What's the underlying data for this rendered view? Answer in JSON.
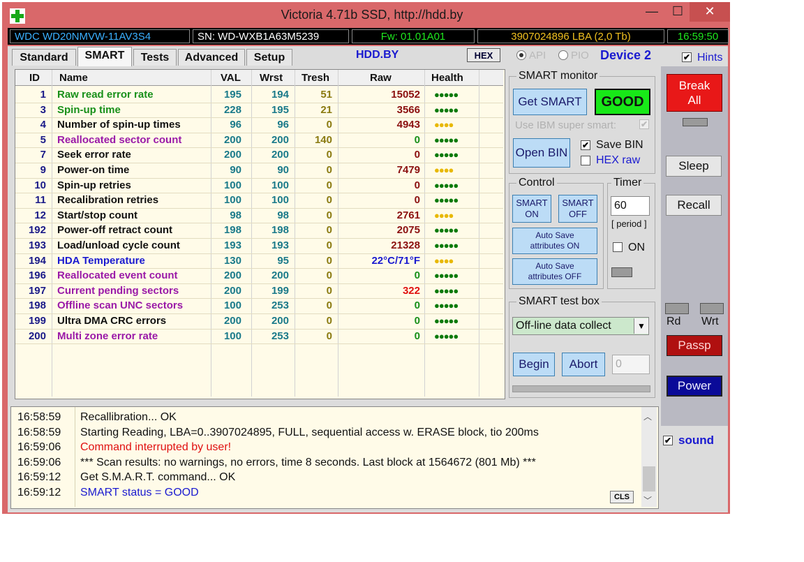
{
  "window": {
    "title": "Victoria 4.71b SSD, http://hdd.by",
    "minimize": "—",
    "maximize": "☐",
    "close": "✕"
  },
  "info_bar": {
    "model": "WDC WD20NMVW-11AV3S4",
    "serial": "SN: WD-WXB1A63M5239",
    "firmware": "Fw: 01.01A01",
    "lba": "3907024896 LBA (2,0 Tb)",
    "clock": "16:59:50"
  },
  "tabs": [
    {
      "label": "Standard",
      "active": false
    },
    {
      "label": "SMART",
      "active": true
    },
    {
      "label": "Tests",
      "active": false
    },
    {
      "label": "Advanced",
      "active": false
    },
    {
      "label": "Setup",
      "active": false
    }
  ],
  "toolbar": {
    "hddby": "HDD.BY",
    "hex_label": "HEX",
    "api_label": "API",
    "pio_label": "PIO",
    "device_label": "Device 2",
    "hints_label": "Hints",
    "hints_checked": true
  },
  "table": {
    "headers": [
      "ID",
      "Name",
      "VAL",
      "Wrst",
      "Tresh",
      "Raw",
      "Health"
    ],
    "rows": [
      {
        "id": "1",
        "name": "Raw read error rate",
        "val": "195",
        "wrst": "194",
        "tresh": "51",
        "raw": "15052",
        "health": "●●●●●",
        "name_color": "#18901a",
        "raw_color": "#8b1010",
        "health_color": "#0a7a0a"
      },
      {
        "id": "3",
        "name": "Spin-up time",
        "val": "228",
        "wrst": "195",
        "tresh": "21",
        "raw": "3566",
        "health": "●●●●●",
        "name_color": "#18901a",
        "raw_color": "#8b1010",
        "health_color": "#0a7a0a"
      },
      {
        "id": "4",
        "name": "Number of spin-up times",
        "val": "96",
        "wrst": "96",
        "tresh": "0",
        "raw": "4943",
        "health": "●●●●",
        "name_color": "#111111",
        "raw_color": "#8b1010",
        "health_color": "#e8b800"
      },
      {
        "id": "5",
        "name": "Reallocated sector count",
        "val": "200",
        "wrst": "200",
        "tresh": "140",
        "raw": "0",
        "health": "●●●●●",
        "name_color": "#9a1aa8",
        "raw_color": "#18901a",
        "health_color": "#0a7a0a"
      },
      {
        "id": "7",
        "name": "Seek error rate",
        "val": "200",
        "wrst": "200",
        "tresh": "0",
        "raw": "0",
        "health": "●●●●●",
        "name_color": "#111111",
        "raw_color": "#8b1010",
        "health_color": "#0a7a0a"
      },
      {
        "id": "9",
        "name": "Power-on time",
        "val": "90",
        "wrst": "90",
        "tresh": "0",
        "raw": "7479",
        "health": "●●●●",
        "name_color": "#111111",
        "raw_color": "#8b1010",
        "health_color": "#e8b800"
      },
      {
        "id": "10",
        "name": "Spin-up retries",
        "val": "100",
        "wrst": "100",
        "tresh": "0",
        "raw": "0",
        "health": "●●●●●",
        "name_color": "#111111",
        "raw_color": "#8b1010",
        "health_color": "#0a7a0a"
      },
      {
        "id": "11",
        "name": "Recalibration retries",
        "val": "100",
        "wrst": "100",
        "tresh": "0",
        "raw": "0",
        "health": "●●●●●",
        "name_color": "#111111",
        "raw_color": "#8b1010",
        "health_color": "#0a7a0a"
      },
      {
        "id": "12",
        "name": "Start/stop count",
        "val": "98",
        "wrst": "98",
        "tresh": "0",
        "raw": "2761",
        "health": "●●●●",
        "name_color": "#111111",
        "raw_color": "#8b1010",
        "health_color": "#e8b800"
      },
      {
        "id": "192",
        "name": "Power-off retract count",
        "val": "198",
        "wrst": "198",
        "tresh": "0",
        "raw": "2075",
        "health": "●●●●●",
        "name_color": "#111111",
        "raw_color": "#8b1010",
        "health_color": "#0a7a0a"
      },
      {
        "id": "193",
        "name": "Load/unload cycle count",
        "val": "193",
        "wrst": "193",
        "tresh": "0",
        "raw": "21328",
        "health": "●●●●●",
        "name_color": "#111111",
        "raw_color": "#8b1010",
        "health_color": "#0a7a0a"
      },
      {
        "id": "194",
        "name": "HDA Temperature",
        "val": "130",
        "wrst": "95",
        "tresh": "0",
        "raw": "22°C/71°F",
        "health": "●●●●",
        "name_color": "#1a1ad0",
        "raw_color": "#1a1ad0",
        "health_color": "#e8b800"
      },
      {
        "id": "196",
        "name": "Reallocated event count",
        "val": "200",
        "wrst": "200",
        "tresh": "0",
        "raw": "0",
        "health": "●●●●●",
        "name_color": "#9a1aa8",
        "raw_color": "#18901a",
        "health_color": "#0a7a0a"
      },
      {
        "id": "197",
        "name": "Current pending sectors",
        "val": "200",
        "wrst": "199",
        "tresh": "0",
        "raw": "322",
        "health": "●●●●●",
        "name_color": "#9a1aa8",
        "raw_color": "#e01010",
        "health_color": "#0a7a0a"
      },
      {
        "id": "198",
        "name": "Offline scan UNC sectors",
        "val": "100",
        "wrst": "253",
        "tresh": "0",
        "raw": "0",
        "health": "●●●●●",
        "name_color": "#9a1aa8",
        "raw_color": "#18901a",
        "health_color": "#0a7a0a"
      },
      {
        "id": "199",
        "name": "Ultra DMA CRC errors",
        "val": "200",
        "wrst": "200",
        "tresh": "0",
        "raw": "0",
        "health": "●●●●●",
        "name_color": "#111111",
        "raw_color": "#18901a",
        "health_color": "#0a7a0a"
      },
      {
        "id": "200",
        "name": "Multi zone error rate",
        "val": "100",
        "wrst": "253",
        "tresh": "0",
        "raw": "0",
        "health": "●●●●●",
        "name_color": "#9a1aa8",
        "raw_color": "#18901a",
        "health_color": "#0a7a0a"
      }
    ]
  },
  "smart_monitor": {
    "title": "SMART monitor",
    "get_smart": "Get SMART",
    "status": "GOOD",
    "ibm_label": "Use IBM super smart:",
    "open_bin": "Open BIN",
    "save_bin": "Save BIN",
    "hex_raw": "HEX raw",
    "save_bin_checked": true,
    "hex_raw_checked": false
  },
  "control": {
    "title": "Control",
    "smart_on_1": "SMART",
    "smart_on_2": "ON",
    "smart_off_1": "SMART",
    "smart_off_2": "OFF",
    "auto_on_1": "Auto Save",
    "auto_on_2": "attributes ON",
    "auto_off_1": "Auto Save",
    "auto_off_2": "attributes OFF"
  },
  "timer": {
    "title": "Timer",
    "value": "60",
    "period": "[ period ]",
    "on_label": "ON"
  },
  "test_box": {
    "title": "SMART test box",
    "selected": "Off-line data collect",
    "begin": "Begin",
    "abort": "Abort",
    "counter": "0"
  },
  "sidebar": {
    "break_1": "Break",
    "break_2": "All",
    "sleep": "Sleep",
    "recall": "Recall",
    "rd": "Rd",
    "wrt": "Wrt",
    "passp": "Passp",
    "power": "Power",
    "sound": "sound",
    "sound_checked": true
  },
  "log": {
    "cls": "CLS",
    "entries": [
      {
        "time": "16:58:59",
        "msg": "Recallibration... OK",
        "color": "#111111"
      },
      {
        "time": "16:58:59",
        "msg": "Starting Reading, LBA=0..3907024895, FULL, sequential access w. ERASE block, tio 200ms",
        "color": "#111111"
      },
      {
        "time": "16:59:06",
        "msg": "Command interrupted by user!",
        "color": "#e01010"
      },
      {
        "time": "16:59:06",
        "msg": "*** Scan results: no warnings, no errors, time 8 seconds. Last block at 1564672 (801 Mb) ***",
        "color": "#111111"
      },
      {
        "time": "16:59:12",
        "msg": "Get S.M.A.R.T. command... OK",
        "color": "#111111"
      },
      {
        "time": "16:59:12",
        "msg": "SMART status = GOOD",
        "color": "#1a1ad0"
      }
    ]
  }
}
